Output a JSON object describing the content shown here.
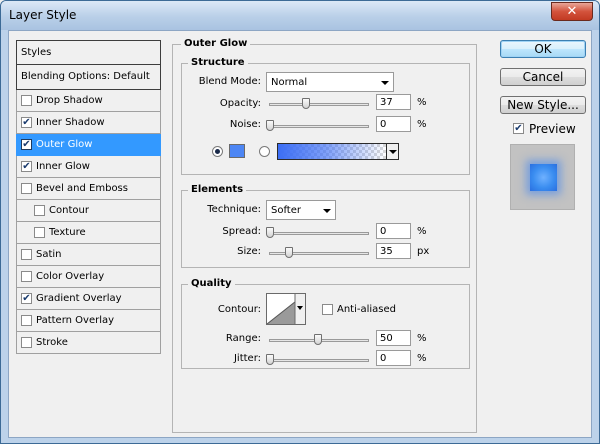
{
  "window": {
    "title": "Layer Style",
    "close_glyph": "✕"
  },
  "styles_list": [
    {
      "label": "Styles",
      "kind": "header",
      "checked": null
    },
    {
      "label": "Blending Options: Default",
      "kind": "blend",
      "checked": null
    },
    {
      "label": "Drop Shadow",
      "kind": "item",
      "checked": false
    },
    {
      "label": "Inner Shadow",
      "kind": "item",
      "checked": true
    },
    {
      "label": "Outer Glow",
      "kind": "item",
      "checked": true,
      "selected": true
    },
    {
      "label": "Inner Glow",
      "kind": "item",
      "checked": true
    },
    {
      "label": "Bevel and Emboss",
      "kind": "item",
      "checked": false
    },
    {
      "label": "Contour",
      "kind": "sub",
      "checked": false
    },
    {
      "label": "Texture",
      "kind": "sub",
      "checked": false
    },
    {
      "label": "Satin",
      "kind": "item",
      "checked": false
    },
    {
      "label": "Color Overlay",
      "kind": "item",
      "checked": false
    },
    {
      "label": "Gradient Overlay",
      "kind": "item",
      "checked": true
    },
    {
      "label": "Pattern Overlay",
      "kind": "item",
      "checked": false
    },
    {
      "label": "Stroke",
      "kind": "item",
      "checked": false
    }
  ],
  "outer_glow": {
    "title": "Outer Glow",
    "structure": {
      "title": "Structure",
      "blend_mode_label": "Blend Mode:",
      "blend_mode_value": "Normal",
      "opacity_label": "Opacity:",
      "opacity_value": "37",
      "opacity_unit": "%",
      "noise_label": "Noise:",
      "noise_value": "0",
      "noise_unit": "%",
      "color_mode": "solid",
      "color_hex": "#4d86f4"
    },
    "elements": {
      "title": "Elements",
      "technique_label": "Technique:",
      "technique_value": "Softer",
      "spread_label": "Spread:",
      "spread_value": "0",
      "spread_unit": "%",
      "size_label": "Size:",
      "size_value": "35",
      "size_unit": "px"
    },
    "quality": {
      "title": "Quality",
      "contour_label": "Contour:",
      "anti_aliased_label": "Anti-aliased",
      "anti_aliased_checked": false,
      "range_label": "Range:",
      "range_value": "50",
      "range_unit": "%",
      "jitter_label": "Jitter:",
      "jitter_value": "0",
      "jitter_unit": "%"
    }
  },
  "buttons": {
    "ok": "OK",
    "cancel": "Cancel",
    "new_style": "New Style..."
  },
  "preview": {
    "label": "Preview",
    "checked": true
  }
}
